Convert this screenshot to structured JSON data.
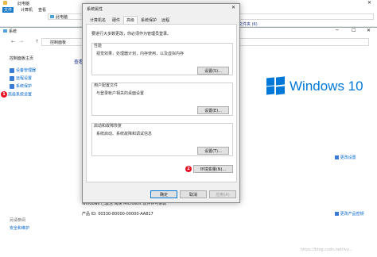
{
  "explorer": {
    "title": "此电脑",
    "ribbon_tabs": [
      "文件",
      "计算机",
      "查看"
    ],
    "address": "此电脑",
    "right_label": "文件夹 (6)"
  },
  "control_panel": {
    "title": "系统",
    "address": "控制面板",
    "sidebar": {
      "home": "控制面板主页",
      "items": [
        "设备管理器",
        "远程设置",
        "系统保护",
        "高级系统设置"
      ],
      "see_also_title": "另请参阅",
      "see_also_items": [
        "安全和维护"
      ]
    },
    "main_heading": "查看",
    "windows_text": "Windows 10",
    "product_id_label": "产品 ID: 00330-80000-00000-AA817",
    "activation_text": "Windows 已激活  阅读 Microsoft 软件许可条款",
    "change_settings": "更改设置",
    "change_product_key": "更改产品密钥",
    "watermark": "https://blog.csdn.net/ivy..."
  },
  "dialog": {
    "title": "系统属性",
    "tabs": [
      "计算机名",
      "硬件",
      "高级",
      "系统保护",
      "远程"
    ],
    "active_tab": 2,
    "admin_note": "要进行大多数更改，你必须作为管理员登录。",
    "groups": [
      {
        "title": "性能",
        "desc": "视觉效果，处理器计划，内存使用，以及虚拟内存",
        "button": "设置(S)..."
      },
      {
        "title": "用户配置文件",
        "desc": "与登录帐户相关的桌面设置",
        "button": "设置(E)..."
      },
      {
        "title": "启动和故障恢复",
        "desc": "系统启动、系统故障和调试信息",
        "button": "设置(T)..."
      }
    ],
    "env_button": "环境变量(N)...",
    "ok": "确定",
    "cancel": "取消",
    "apply": "应用(A)"
  },
  "badges": [
    "1",
    "2"
  ],
  "colors": {
    "accent": "#0078d7",
    "badge": "#e81123",
    "logo": "#0078d7"
  }
}
